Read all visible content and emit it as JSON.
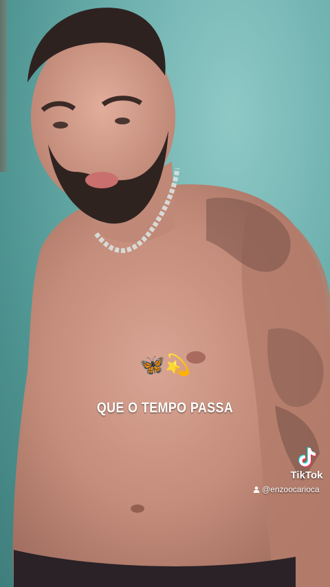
{
  "video": {
    "caption_emoji": "🦋💫",
    "caption_text": "QUE O TEMPO PASSA"
  },
  "watermark": {
    "brand": "TikTok",
    "brand_icon": "tiktok-note-icon",
    "user_icon": "user-icon",
    "handle": "@enzoocarioca"
  },
  "colors": {
    "background": "#5fa8a4",
    "text": "#ffffff",
    "tiktok_cyan": "#25f4ee",
    "tiktok_red": "#fe2c55"
  }
}
